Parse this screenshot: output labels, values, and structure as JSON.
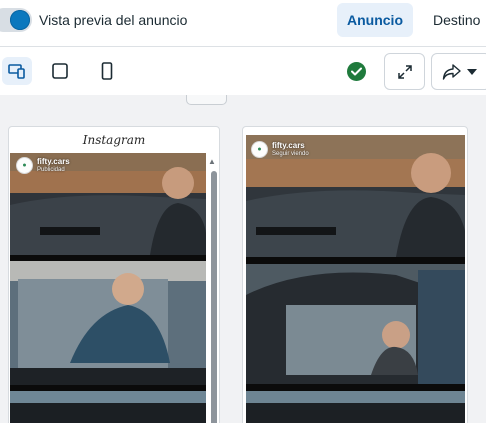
{
  "header": {
    "toggle_label": "Vista previa del anuncio",
    "tabs": [
      {
        "label": "Anuncio",
        "active": true
      },
      {
        "label": "Destino",
        "active": false
      }
    ]
  },
  "toolbar": {
    "view_buttons": [
      "desktop-mobile-icon",
      "square-icon",
      "phone-icon"
    ],
    "status_icon": "checkmark-circle-icon",
    "expand_icon": "expand-icon",
    "share_icon": "share-icon"
  },
  "previews": {
    "left": {
      "platform": "Instagram",
      "account": "fifty.cars",
      "subtitle": "Publicidad"
    },
    "right": {
      "account": "fifty.cars",
      "subtitle": "Seguir viendo"
    }
  },
  "colors": {
    "accent": "#0a78be",
    "active_tab_bg": "#e7f0fa",
    "success": "#1f7a3c"
  }
}
